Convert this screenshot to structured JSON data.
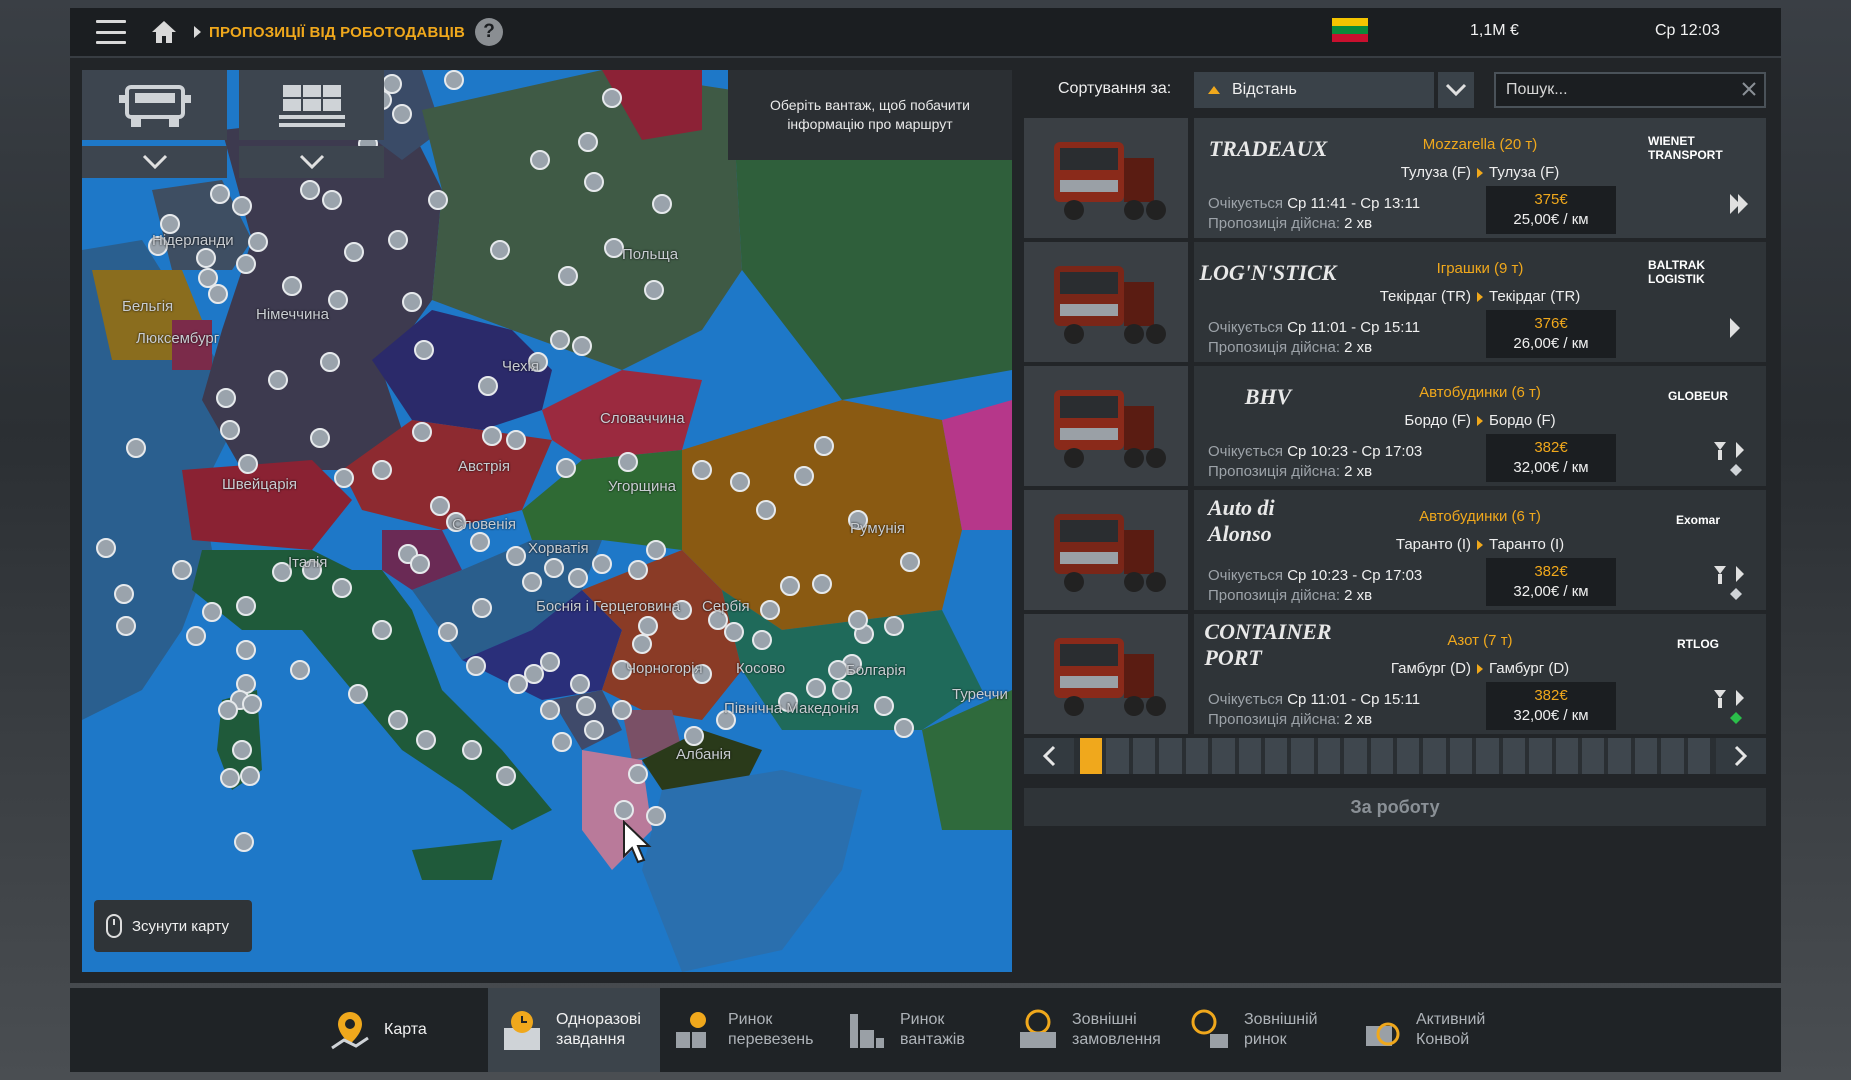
{
  "topbar": {
    "title": "ПРОПОЗИЦІЇ ВІД РОБОТОДАВЦІВ",
    "help": "?",
    "money": "1,1M €",
    "time": "Ср 12:03",
    "flag_colors": [
      "#f4c400",
      "#0b8a3a",
      "#c8102e"
    ]
  },
  "map": {
    "hint": "Оберіть вантаж, щоб побачити інформацію про маршрут",
    "move_map": "Зсунути карту",
    "countries": [
      {
        "name": "Нідерланди"
      },
      {
        "name": "Бельгія"
      },
      {
        "name": "Люксембург"
      },
      {
        "name": "Німеччина"
      },
      {
        "name": "Польща"
      },
      {
        "name": "Чехія"
      },
      {
        "name": "Словаччина"
      },
      {
        "name": "Австрія"
      },
      {
        "name": "Швейцарія"
      },
      {
        "name": "Угорщина"
      },
      {
        "name": "Румунія"
      },
      {
        "name": "Словенія"
      },
      {
        "name": "Хорватія"
      },
      {
        "name": "Італія"
      },
      {
        "name": "Боснія і Герцеговина"
      },
      {
        "name": "Сербія"
      },
      {
        "name": "Чорногорія"
      },
      {
        "name": "Косово"
      },
      {
        "name": "Болгарія"
      },
      {
        "name": "Північна Македонія"
      },
      {
        "name": "Албанія"
      },
      {
        "name": "Туреччи"
      }
    ]
  },
  "sort": {
    "label": "Сортування за:",
    "selected": "Відстань",
    "search_placeholder": "Пошук..."
  },
  "jobs": [
    {
      "company": "TRADEAUX",
      "receiver": "WIENET TRANSPORT",
      "cargo": "Mozzarella (20 т)",
      "from": "Тулуза (F)",
      "to": "Тулуза (F)",
      "expected_label": "Очікується",
      "expected": "Ср 11:41 - Ср 13:11",
      "valid_label": "Пропозиція дійсна:",
      "valid": "2 хв",
      "pay": "375€",
      "rate": "25,00€ / км"
    },
    {
      "company": "LOG'N'STICK",
      "receiver": "BALTRAK LOGISTIK",
      "cargo": "Іграшки (9 т)",
      "from": "Текірдаг (TR)",
      "to": "Текірдаг (TR)",
      "expected_label": "Очікується",
      "expected": "Ср 11:01 - Ср 15:11",
      "valid_label": "Пропозиція дійсна:",
      "valid": "2 хв",
      "pay": "376€",
      "rate": "26,00€ / км"
    },
    {
      "company": "BHV",
      "receiver": "GLOBEUR",
      "cargo": "Автобудинки (6 т)",
      "from": "Бордо (F)",
      "to": "Бордо (F)",
      "expected_label": "Очікується",
      "expected": "Ср 10:23 - Ср 17:03",
      "valid_label": "Пропозиція дійсна:",
      "valid": "2 хв",
      "pay": "382€",
      "rate": "32,00€ / км"
    },
    {
      "company": "Auto di Alonso",
      "receiver": "Exomar",
      "cargo": "Автобудинки (6 т)",
      "from": "Таранто (I)",
      "to": "Таранто (I)",
      "expected_label": "Очікується",
      "expected": "Ср 10:23 - Ср 17:03",
      "valid_label": "Пропозиція дійсна:",
      "valid": "2 хв",
      "pay": "382€",
      "rate": "32,00€ / км"
    },
    {
      "company": "CONTAINER PORT",
      "receiver": "RTLOG",
      "cargo": "Азот (7 т)",
      "from": "Гамбург (D)",
      "to": "Гамбург (D)",
      "expected_label": "Очікується",
      "expected": "Ср 11:01 - Ср 15:11",
      "valid_label": "Пропозиція дійсна:",
      "valid": "2 хв",
      "pay": "382€",
      "rate": "32,00€ / км"
    }
  ],
  "pager": {
    "current": 1,
    "total": 24
  },
  "take_job": "За роботу",
  "tabs": [
    {
      "label": "Карта",
      "icon": "map-pin-icon"
    },
    {
      "label": "Одноразові\nзавдання",
      "icon": "clock-box-icon"
    },
    {
      "label": "Ринок\nперевезень",
      "icon": "freight-market-icon"
    },
    {
      "label": "Ринок\nвантажів",
      "icon": "cargo-market-icon"
    },
    {
      "label": "Зовнішні\nзамовлення",
      "icon": "globe-box-icon"
    },
    {
      "label": "Зовнішній\nринок",
      "icon": "globe-truck-icon"
    },
    {
      "label": "Активний\nКонвой",
      "icon": "convoy-icon"
    }
  ],
  "colors": {
    "accent": "#f0a81c",
    "sea": "#1e78c8"
  }
}
